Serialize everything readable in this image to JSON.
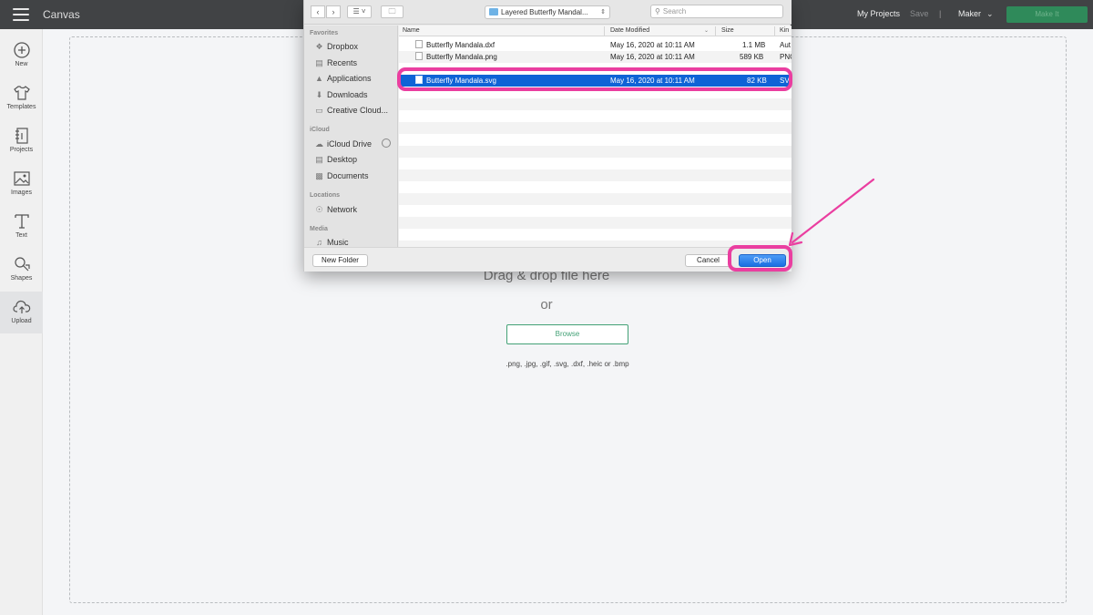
{
  "app": {
    "title": "Canvas",
    "my_projects": "My Projects",
    "save": "Save",
    "separator": "|",
    "machine": "Maker",
    "make_it": "Make It"
  },
  "sidebar": {
    "items": [
      {
        "label": "New",
        "icon": "plus-circle-icon"
      },
      {
        "label": "Templates",
        "icon": "shirt-icon"
      },
      {
        "label": "Projects",
        "icon": "notebook-icon"
      },
      {
        "label": "Images",
        "icon": "image-icon"
      },
      {
        "label": "Text",
        "icon": "text-t-icon"
      },
      {
        "label": "Shapes",
        "icon": "shapes-icon"
      },
      {
        "label": "Upload",
        "icon": "cloud-upload-icon"
      }
    ]
  },
  "upload": {
    "drag_text": "Drag & drop file here",
    "or_text": "or",
    "browse_label": "Browse",
    "formats": ".png, .jpg, .gif, .svg, .dxf, .heic or .bmp"
  },
  "dialog": {
    "path": "Layered Butterfly Mandal...",
    "search_placeholder": "Search",
    "sections": {
      "favorites": "Favorites",
      "icloud": "iCloud",
      "locations": "Locations",
      "media": "Media"
    },
    "favorites": [
      {
        "label": "Dropbox",
        "icon": "dropbox-icon"
      },
      {
        "label": "Recents",
        "icon": "recents-icon"
      },
      {
        "label": "Applications",
        "icon": "applications-icon"
      },
      {
        "label": "Downloads",
        "icon": "downloads-icon"
      },
      {
        "label": "Creative Cloud...",
        "icon": "folder-icon"
      }
    ],
    "icloud": [
      {
        "label": "iCloud Drive",
        "icon": "cloud-icon"
      },
      {
        "label": "Desktop",
        "icon": "desktop-icon"
      },
      {
        "label": "Documents",
        "icon": "document-icon"
      }
    ],
    "locations": [
      {
        "label": "Network",
        "icon": "globe-icon"
      }
    ],
    "media": [
      {
        "label": "Music",
        "icon": "music-note-icon"
      }
    ],
    "columns": {
      "name": "Name",
      "date": "Date Modified",
      "size": "Size",
      "kind": "Kin"
    },
    "files": [
      {
        "name": "Butterfly Mandala.dxf",
        "date": "May 16, 2020 at 10:11 AM",
        "size": "1.1 MB",
        "kind": "Aut"
      },
      {
        "name": "Butterfly Mandala.png",
        "date": "May 16, 2020 at 10:11 AM",
        "size": "589 KB",
        "kind": "PNG"
      },
      {
        "name": "Butterfly Mandala.svg",
        "date": "May 16, 2020 at 10:11 AM",
        "size": "82 KB",
        "kind": "SVG"
      }
    ],
    "new_folder": "New Folder",
    "cancel": "Cancel",
    "open": "Open"
  },
  "colors": {
    "topbar": "#414345",
    "accent_green": "#43a176",
    "selection_blue": "#0f63d6",
    "highlight_pink": "#ea3ea0"
  }
}
